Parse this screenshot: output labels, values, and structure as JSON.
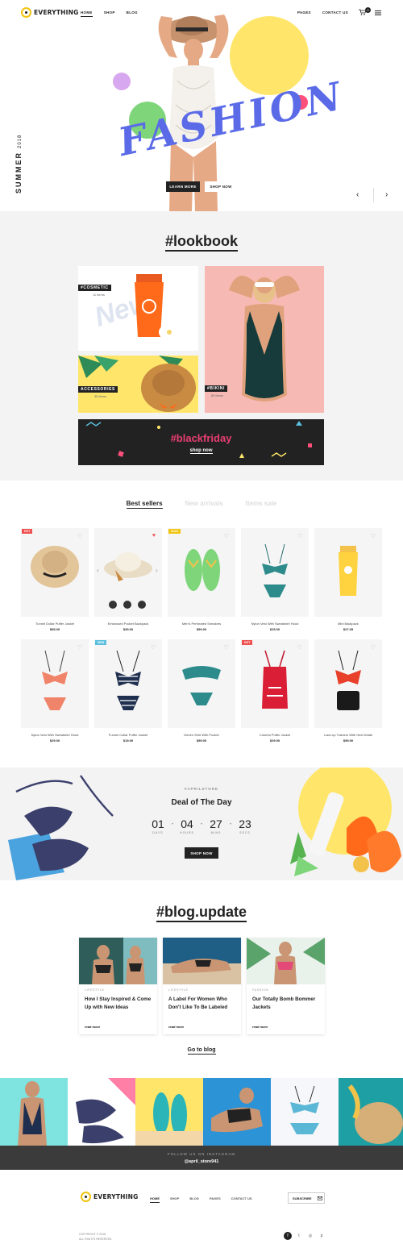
{
  "header": {
    "logo": "EVERYTHING",
    "nav_left": [
      "HOME",
      "SHOP",
      "BLOG"
    ],
    "nav_right": [
      "PAGES",
      "CONTACT US"
    ],
    "cart_count": "0"
  },
  "hero": {
    "season": "SUMMER",
    "year": "2018",
    "headline": "FASHION",
    "btn_learn": "LEARN MORE",
    "btn_shop": "SHOP NOW",
    "prev": "‹",
    "next": "›"
  },
  "lookbook": {
    "title": "#lookbook",
    "cards": [
      {
        "tag": "#COSMETIC",
        "count": "11 items"
      },
      {
        "tag": "ACCESSORIES",
        "count": "38 items"
      },
      {
        "tag": "#BIKINI",
        "count": "89 items"
      }
    ],
    "banner_title": "#blackfriday",
    "banner_link": "shop now",
    "colors": {
      "pink": "#e83e73",
      "yellow": "#ffe66b",
      "peach": "#f7b9b3"
    }
  },
  "products": {
    "tabs": [
      "Best sellers",
      "New arrivals",
      "Items sale"
    ],
    "items": [
      {
        "name": "Tunnel Dollar Puffer Jacket",
        "price": "$59.00",
        "badge": "HOT",
        "badge_color": "#f05050",
        "kind": "hat"
      },
      {
        "name": "Embossed Pocket Backpack",
        "price": "$39.00",
        "badge": "",
        "badge_color": "",
        "kind": "hat2"
      },
      {
        "name": "Men's Perforated Sneakers",
        "price": "$59.00",
        "badge": "SALE",
        "badge_color": "#f1c40f",
        "kind": "sandals"
      },
      {
        "name": "Nylon Vest With Sweatshirt Hood",
        "price": "$15.00",
        "badge": "",
        "badge_color": "",
        "kind": "bikini"
      },
      {
        "name": "Mini Backpack",
        "price": "$27.05",
        "badge": "",
        "badge_color": "",
        "kind": "sunscreen"
      },
      {
        "name": "Nylon Vest With Sweatshirt Hood",
        "price": "$29.00",
        "badge": "",
        "badge_color": "",
        "kind": "bikini2"
      },
      {
        "name": "Funnel Collar Puffer Jacket",
        "price": "$19.00",
        "badge": "NEW",
        "badge_color": "#5bc0de",
        "kind": "bikini3"
      },
      {
        "name": "Denim Shirt With Pocket",
        "price": "$59.00",
        "badge": "",
        "badge_color": "",
        "kind": "bikini4"
      },
      {
        "name": "Colorful Puffer Jacket",
        "price": "$29.00",
        "badge": "HOT",
        "badge_color": "#f05050",
        "kind": "swimsuit"
      },
      {
        "name": "Lace-up Trainers With Heel Detail",
        "price": "$59.00",
        "badge": "",
        "badge_color": "",
        "kind": "bikini5"
      }
    ]
  },
  "deal": {
    "kicker": "#APRILSTORE",
    "title": "Deal of The Day",
    "countdown": [
      {
        "num": "01",
        "label": "DAYS"
      },
      {
        "num": "04",
        "label": "HOURS"
      },
      {
        "num": "27",
        "label": "MINS"
      },
      {
        "num": "23",
        "label": "SECS"
      }
    ],
    "button": "SHOP NOW"
  },
  "blog": {
    "title": "#blog.update",
    "posts": [
      {
        "category": "LIFESTYLE",
        "title": "How I Stay Inspired & Come Up with New Ideas",
        "more": "read more"
      },
      {
        "category": "LIFESTYLE",
        "title": "A Label For Women Who Don't Like To Be Labeled",
        "more": "read more"
      },
      {
        "category": "FASHION",
        "title": "Our Totally Bomb Bommer Jackets",
        "more": "read more"
      }
    ],
    "goto": "Go to blog"
  },
  "instagram": {
    "title": "FOLLOW US ON INSTAGRAM",
    "handle": "@april_store941"
  },
  "footer": {
    "logo": "EVERYTHING",
    "nav": [
      "HOME",
      "SHOP",
      "BLOG",
      "PAGES",
      "CONTACT US"
    ],
    "subscribe": "SUBSCRIBE",
    "copyright_1": "COPYRIGHT © 2018",
    "copyright_2": "ALL RIGHTS RESERVED",
    "social": [
      "facebook-icon",
      "twitter-icon",
      "instagram-icon",
      "pinterest-icon"
    ]
  }
}
